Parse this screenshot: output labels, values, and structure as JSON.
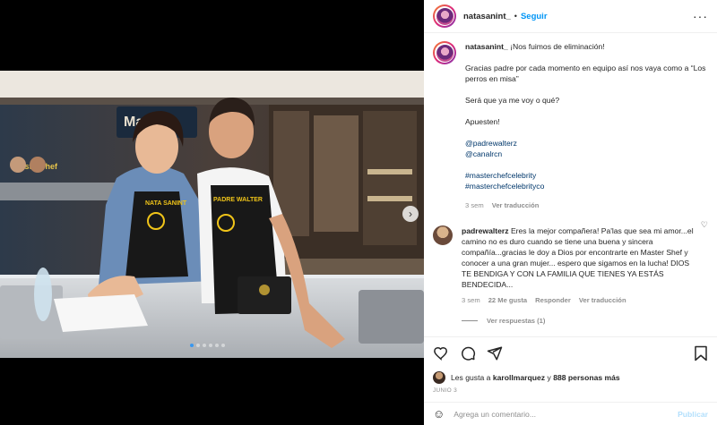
{
  "post": {
    "username": "natasanint_",
    "separator": "•",
    "follow_label": "Seguir",
    "more_label": "···"
  },
  "media": {
    "apron_left": "NATA SANINT",
    "apron_right": "PADRE WALTER",
    "bg_sign": "Maste",
    "bg_sign2": "MasterChef",
    "next_label": "›"
  },
  "caption": {
    "username": "natasanint_",
    "headline": "¡Nos fuimos de eliminación!",
    "p1": "Gracias padre por cada momento en equipo así nos vaya como a “Los perros en misa”",
    "p2": "Será que ya me voy o qué?",
    "p3": "Apuesten!",
    "mention1": "@padrewalterz",
    "mention2": "@canalrcn",
    "tag1": "#masterchefcelebrity",
    "tag2": "#masterchefcelebrityco",
    "time": "3 sem",
    "translate": "Ver traducción"
  },
  "comment": {
    "username": "padrewalterz",
    "text": "Eres la mejor compañera! Pa'las que sea mi amor...el camino no es duro cuando se tiene una buena y sincera compañía...gracias le doy a Dios por encontrarte en Master Shef y conocer a una gran mujer... espero que sigamos en la lucha! DIOS TE BENDIGA Y CON LA FAMILIA QUE TIENES YA ESTÁS BENDECIDA...",
    "time": "3 sem",
    "likes": "22 Me gusta",
    "reply": "Responder",
    "translate": "Ver traducción",
    "replies": "Ver respuestas (1)",
    "heart": "♡"
  },
  "actions": {
    "likes_prefix": "Les gusta a",
    "likes_user": "karollmarquez",
    "likes_middle": "y",
    "likes_others": "888 personas más",
    "date": "JUNIO 3"
  },
  "add_comment": {
    "placeholder": "Agrega un comentario...",
    "publish": "Publicar"
  }
}
